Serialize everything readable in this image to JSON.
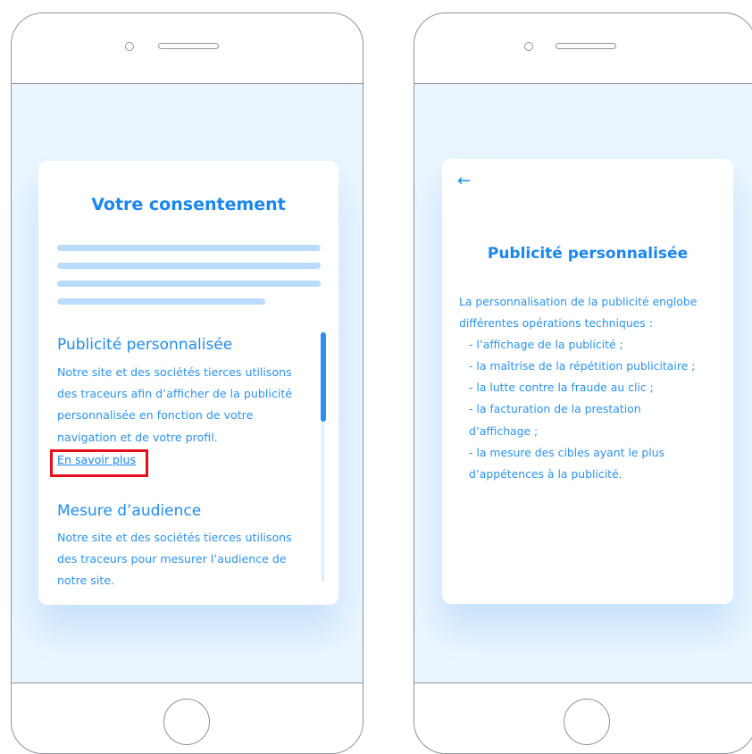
{
  "left_screen": {
    "title": "Votre consentement",
    "sections": [
      {
        "heading": "Publicité personnalisée",
        "text": "Notre site et des sociétés tierces utilisons des traceurs afin d’afficher de la publicité personnalisée en fonction de votre navigation et de votre profil.",
        "link": "En savoir plus"
      },
      {
        "heading": "Mesure d’audience",
        "text": "Notre site et des sociétés tierces utilisons des traceurs pour mesurer l’audience de notre site."
      }
    ],
    "highlight_color": "#e50f1c"
  },
  "right_screen": {
    "back_icon": "←",
    "title": "Publicité personnalisée",
    "intro": "La personnalisation de la publicité englobe différentes opérations techniques :",
    "items": [
      "- l’affichage de la publicité ;",
      "- la maîtrise de la répétition publicitaire ;",
      "- la lutte contre la fraude au clic ;",
      "- la facturation de la prestation d’affichage ;",
      "- la mesure des cibles ayant le plus d’appétences à la publicité."
    ]
  },
  "colors": {
    "accent": "#1a8ff2",
    "screen_bg": "#eaf5ff",
    "device_outline": "#8f9498"
  }
}
